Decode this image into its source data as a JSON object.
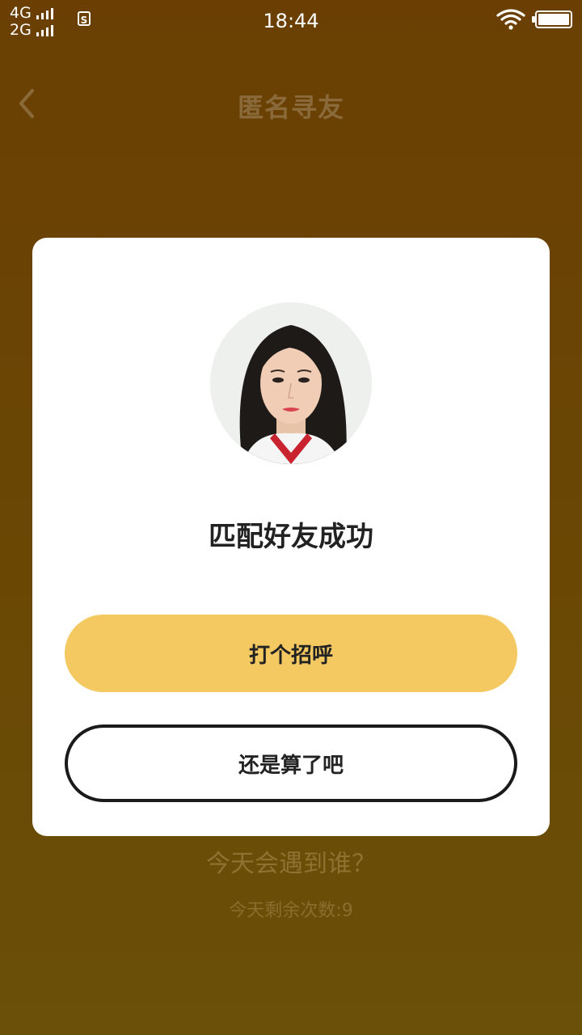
{
  "status_bar": {
    "net1": "4G",
    "net2": "2G",
    "sim_label": "S",
    "time": "18:44"
  },
  "header": {
    "title": "匿名寻友"
  },
  "background": {
    "question": "今天会遇到谁？",
    "remaining": "今天剩余次数:9"
  },
  "dialog": {
    "title": "匹配好友成功",
    "greet_label": "打个招呼",
    "dismiss_label": "还是算了吧"
  },
  "colors": {
    "background": "#6a4704",
    "accent": "#f5c961",
    "dialog": "#ffffff"
  },
  "icons": {
    "back": "chevron-left-icon",
    "wifi": "wifi-icon",
    "battery": "battery-icon",
    "sim": "sim-icon"
  }
}
